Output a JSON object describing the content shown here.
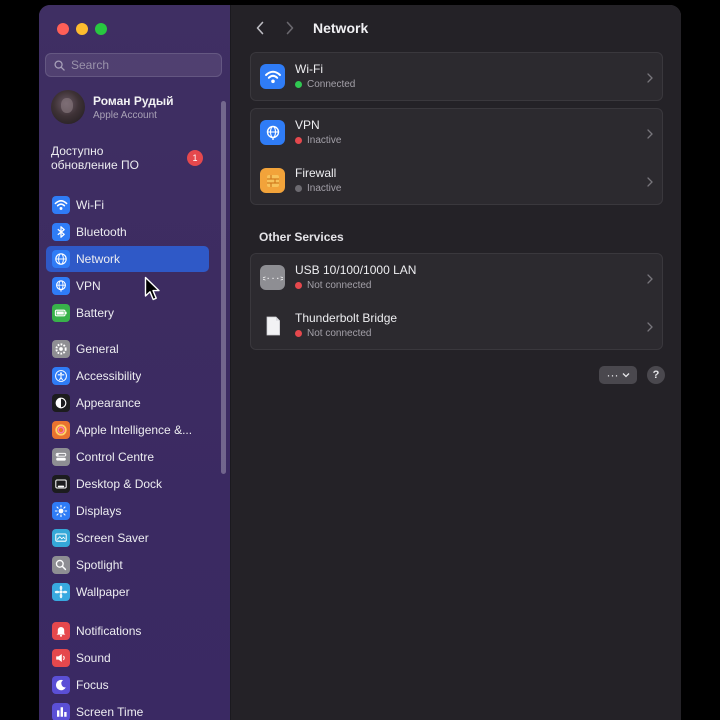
{
  "search": {
    "placeholder": "Search"
  },
  "account": {
    "name": "Роман Рудый",
    "subtitle": "Apple Account"
  },
  "update": {
    "text": "Доступно обновление ПО",
    "badge": "1"
  },
  "sidebar": {
    "group1": [
      {
        "label": "Wi-Fi",
        "icon": "wifi-icon",
        "color": "#2f7cf6"
      },
      {
        "label": "Bluetooth",
        "icon": "bluetooth-icon",
        "color": "#2f7cf6"
      },
      {
        "label": "Network",
        "icon": "globe-icon",
        "color": "#2f7cf6",
        "selected": true
      },
      {
        "label": "VPN",
        "icon": "vpn-globe-icon",
        "color": "#2f7cf6"
      },
      {
        "label": "Battery",
        "icon": "battery-icon",
        "color": "#38b24a"
      }
    ],
    "group2": [
      {
        "label": "General",
        "icon": "gear-icon",
        "color": "#8e8e93"
      },
      {
        "label": "Accessibility",
        "icon": "accessibility-icon",
        "color": "#2f7cf6"
      },
      {
        "label": "Appearance",
        "icon": "appearance-icon",
        "color": "#1c1c1e"
      },
      {
        "label": "Apple Intelligence &...",
        "icon": "apple-intelligence-icon",
        "color": "#e9732f"
      },
      {
        "label": "Control Centre",
        "icon": "control-centre-icon",
        "color": "#8e8e93"
      },
      {
        "label": "Desktop & Dock",
        "icon": "dock-icon",
        "color": "#1c1c1e"
      },
      {
        "label": "Displays",
        "icon": "displays-icon",
        "color": "#2f7cf6"
      },
      {
        "label": "Screen Saver",
        "icon": "screen-saver-icon",
        "color": "#35a8d8"
      },
      {
        "label": "Spotlight",
        "icon": "spotlight-icon",
        "color": "#8e8e93"
      },
      {
        "label": "Wallpaper",
        "icon": "wallpaper-icon",
        "color": "#38a9e0"
      }
    ],
    "group3": [
      {
        "label": "Notifications",
        "icon": "notifications-icon",
        "color": "#e5484d"
      },
      {
        "label": "Sound",
        "icon": "sound-icon",
        "color": "#e5484d"
      },
      {
        "label": "Focus",
        "icon": "focus-icon",
        "color": "#5b4fd6"
      },
      {
        "label": "Screen Time",
        "icon": "screen-time-icon",
        "color": "#5b4fd6"
      }
    ]
  },
  "toolbar": {
    "title": "Network"
  },
  "services": [
    {
      "title": "Wi-Fi",
      "status": "Connected",
      "status_color": "#30c852",
      "icon": "wifi-icon",
      "icon_color": "#2f7cf6"
    }
  ],
  "services2": [
    {
      "title": "VPN",
      "status": "Inactive",
      "status_color": "#e5484d",
      "icon": "vpn-globe-icon",
      "icon_color": "#2f7cf6"
    },
    {
      "title": "Firewall",
      "status": "Inactive",
      "status_color": "#6c6a70",
      "icon": "firewall-icon",
      "icon_color": "#f2a33a"
    }
  ],
  "other_services": {
    "title": "Other Services",
    "items": [
      {
        "title": "USB 10/100/1000 LAN",
        "status": "Not connected",
        "status_color": "#e5484d",
        "icon": "ethernet-icon",
        "icon_color": "#8e8e93"
      },
      {
        "title": "Thunderbolt Bridge",
        "status": "Not connected",
        "status_color": "#e5484d",
        "icon": "document-icon",
        "icon_color": "#f4f4f6"
      }
    ]
  },
  "actions": {
    "more": "···",
    "help": "?"
  }
}
